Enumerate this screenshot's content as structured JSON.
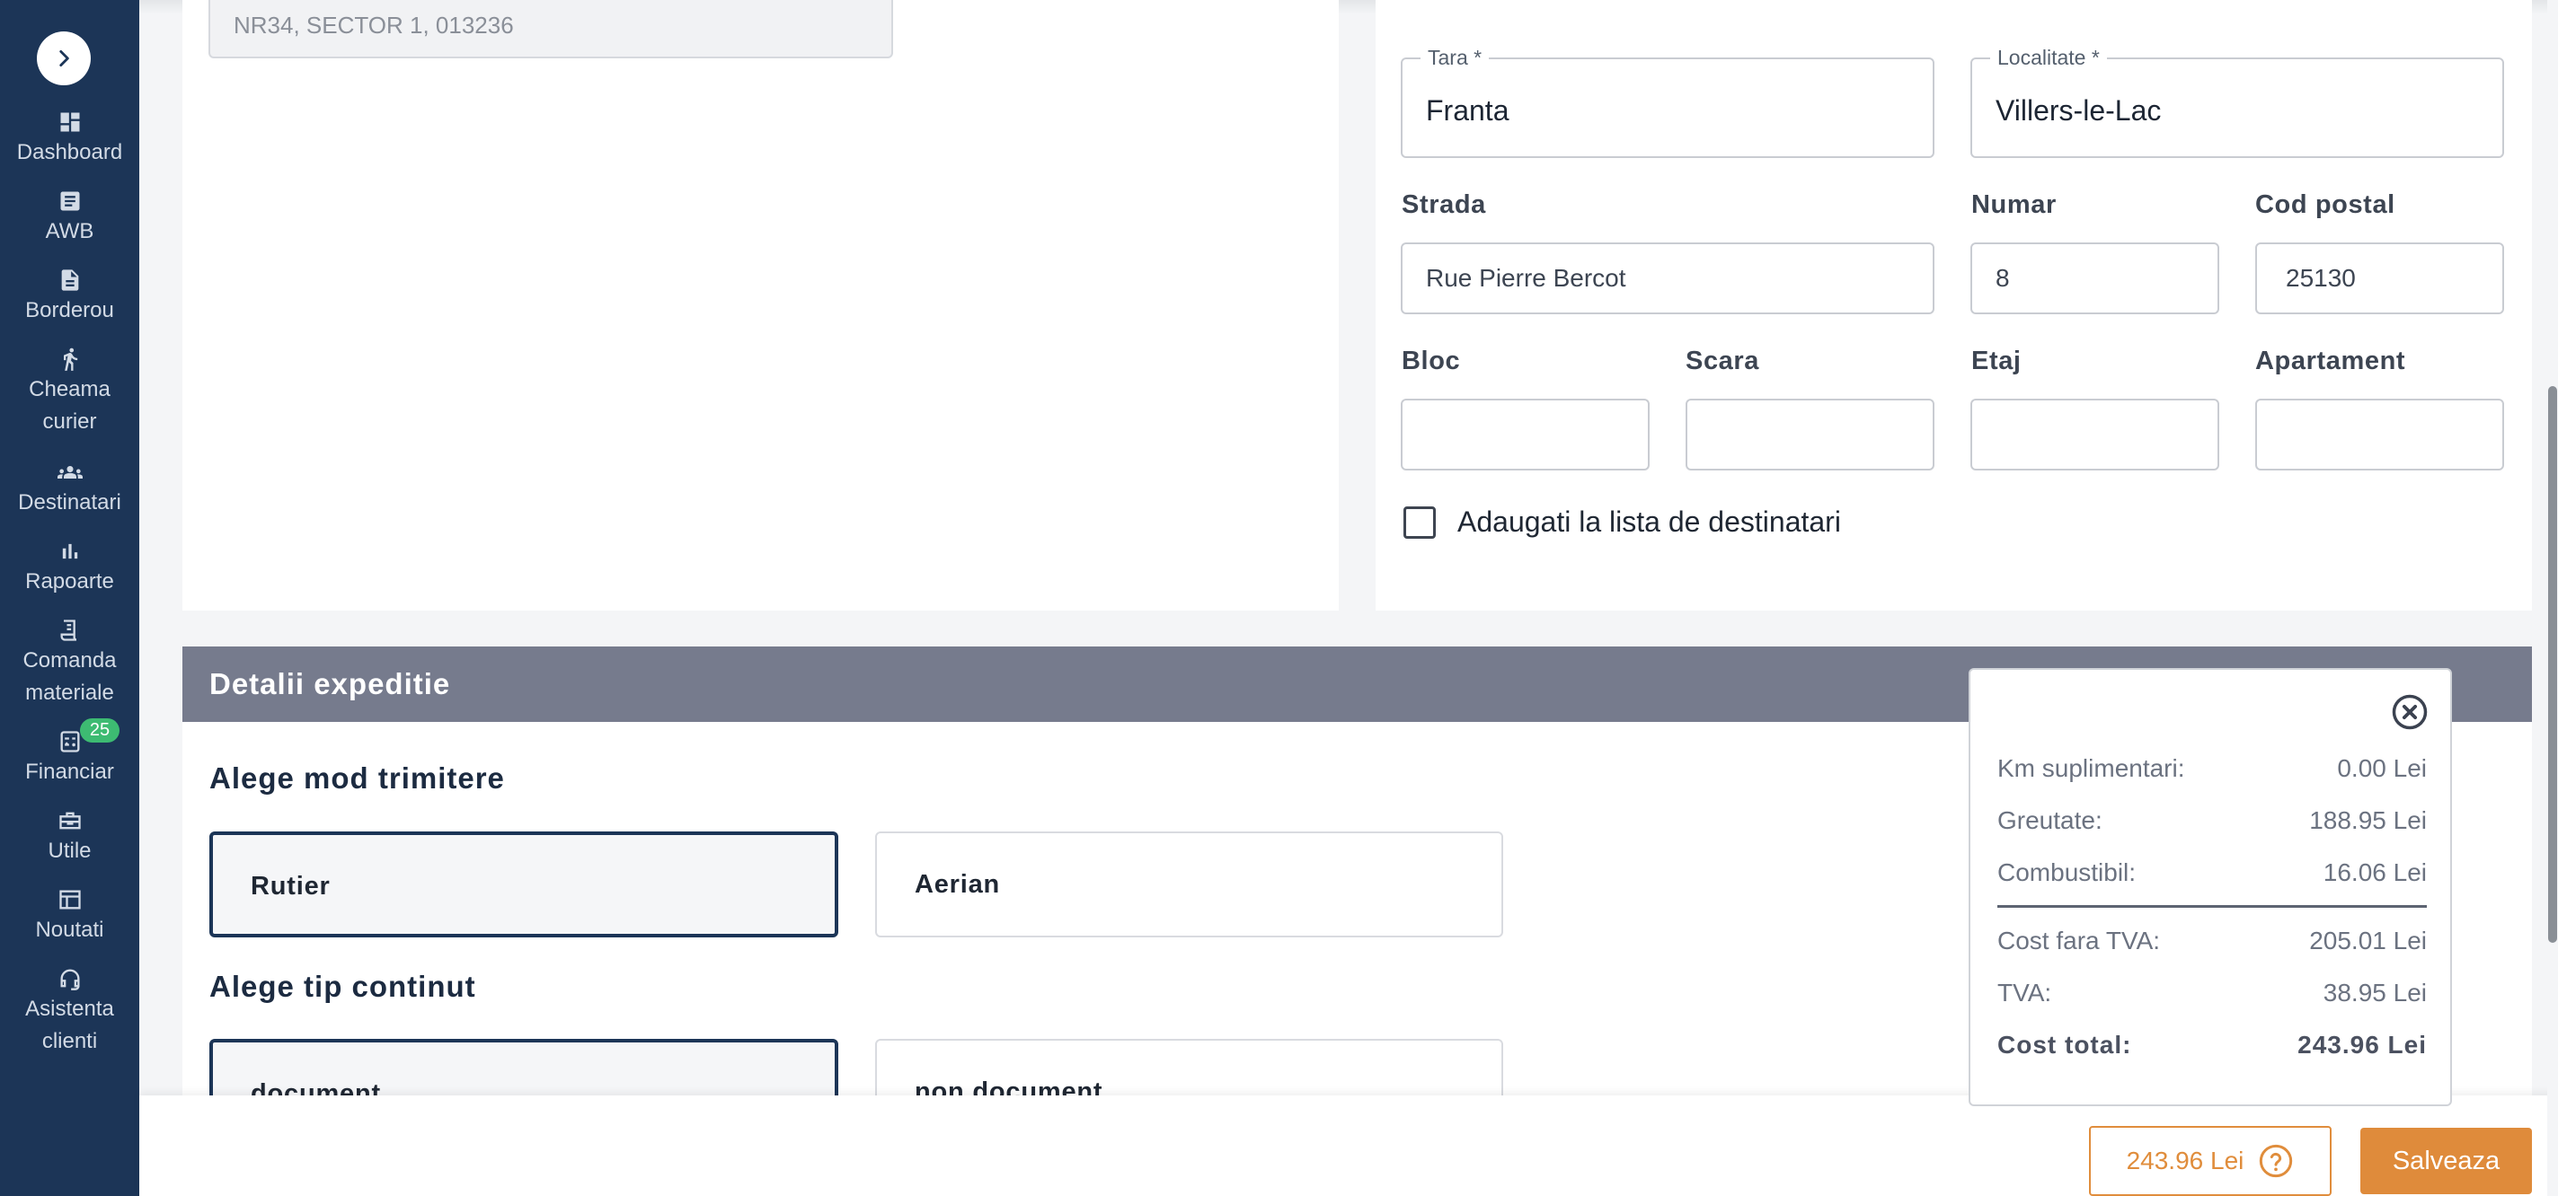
{
  "sidebar": {
    "items": [
      {
        "label": "Dashboard",
        "icon": "dashboard-icon"
      },
      {
        "label": "AWB",
        "icon": "document-icon"
      },
      {
        "label": "Borderou",
        "icon": "file-icon"
      },
      {
        "label": "Cheama curier",
        "icon": "courier-icon"
      },
      {
        "label": "Destinatari",
        "icon": "people-icon"
      },
      {
        "label": "Rapoarte",
        "icon": "bar-chart-icon"
      },
      {
        "label": "Comanda materiale",
        "icon": "receipt-icon"
      },
      {
        "label": "Financiar",
        "icon": "calculator-icon",
        "badge": "25"
      },
      {
        "label": "Utile",
        "icon": "toolbox-icon"
      },
      {
        "label": "Noutati",
        "icon": "news-icon"
      },
      {
        "label": "Asistenta clienti",
        "icon": "headset-icon"
      }
    ]
  },
  "left_card": {
    "address_value": "NR34, SECTOR 1, 013236"
  },
  "right_card": {
    "tara": {
      "label": "Tara *",
      "value": "Franta"
    },
    "localitate": {
      "label": "Localitate *",
      "value": "Villers-le-Lac"
    },
    "strada": {
      "label": "Strada",
      "value": "Rue Pierre Bercot"
    },
    "numar": {
      "label": "Numar",
      "value": "8"
    },
    "cod_postal": {
      "label": "Cod postal",
      "value": "25130"
    },
    "bloc": {
      "label": "Bloc",
      "value": ""
    },
    "scara": {
      "label": "Scara",
      "value": ""
    },
    "etaj": {
      "label": "Etaj",
      "value": ""
    },
    "apartament": {
      "label": "Apartament",
      "value": ""
    },
    "checkbox_label": "Adaugati la lista de destinatari",
    "checkbox_checked": false
  },
  "detalii": {
    "header": "Detalii expeditie",
    "mod_title": "Alege mod trimitere",
    "mod_options": [
      "Rutier",
      "Aerian"
    ],
    "mod_selected": "Rutier",
    "tip_title": "Alege tip continut",
    "tip_options": [
      "document",
      "non document"
    ],
    "tip_selected": "document"
  },
  "price_popup": {
    "rows": [
      {
        "label": "Km suplimentari:",
        "value": "0.00 Lei"
      },
      {
        "label": "Greutate:",
        "value": "188.95 Lei"
      },
      {
        "label": "Combustibil:",
        "value": "16.06 Lei"
      },
      {
        "label": "Cost fara TVA:",
        "value": "205.01 Lei"
      },
      {
        "label": "TVA:",
        "value": "38.95 Lei"
      },
      {
        "label": "Cost total:",
        "value": "243.96 Lei"
      }
    ]
  },
  "footer": {
    "price_label": "243.96 Lei",
    "save_label": "Salveaza"
  },
  "colors": {
    "sidebar_bg": "#1c3557",
    "accent_orange": "#df8b3b",
    "section_header_bg": "#767b8d",
    "badge_green": "#3dbb72"
  }
}
